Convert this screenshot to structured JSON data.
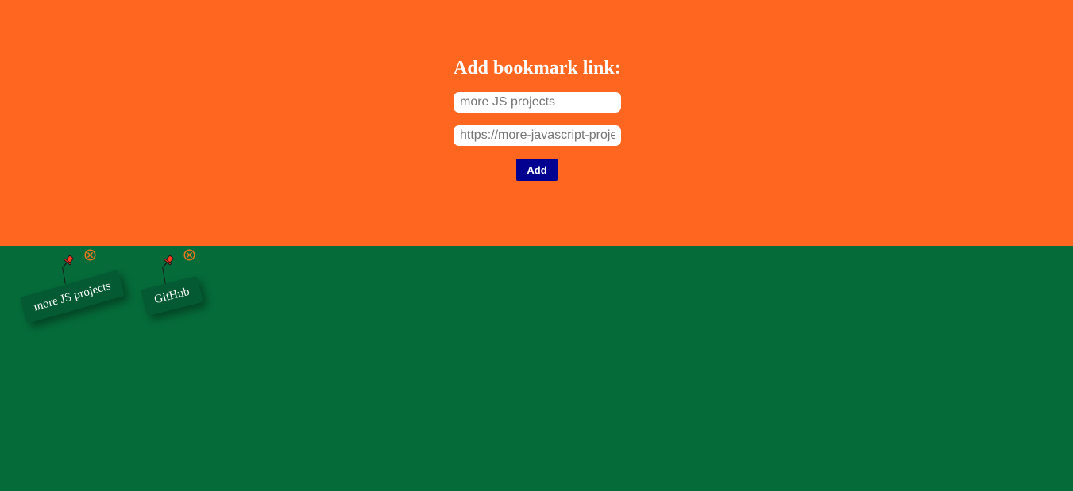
{
  "form": {
    "title": "Add bookmark link:",
    "name_placeholder": "more JS projects",
    "url_placeholder": "https://more-javascript-projects",
    "add_label": "Add"
  },
  "bookmarks": [
    {
      "label": "more JS projects"
    },
    {
      "label": "GitHub"
    }
  ],
  "colors": {
    "top_bg": "#ff6720",
    "bottom_bg": "#056b39",
    "note_bg": "#045a32",
    "button_bg": "#020190",
    "pin": "#ff3b1f",
    "delete_icon": "#e8771f"
  },
  "icons": {
    "pin": "pushpin-icon",
    "delete": "circle-x-icon"
  }
}
